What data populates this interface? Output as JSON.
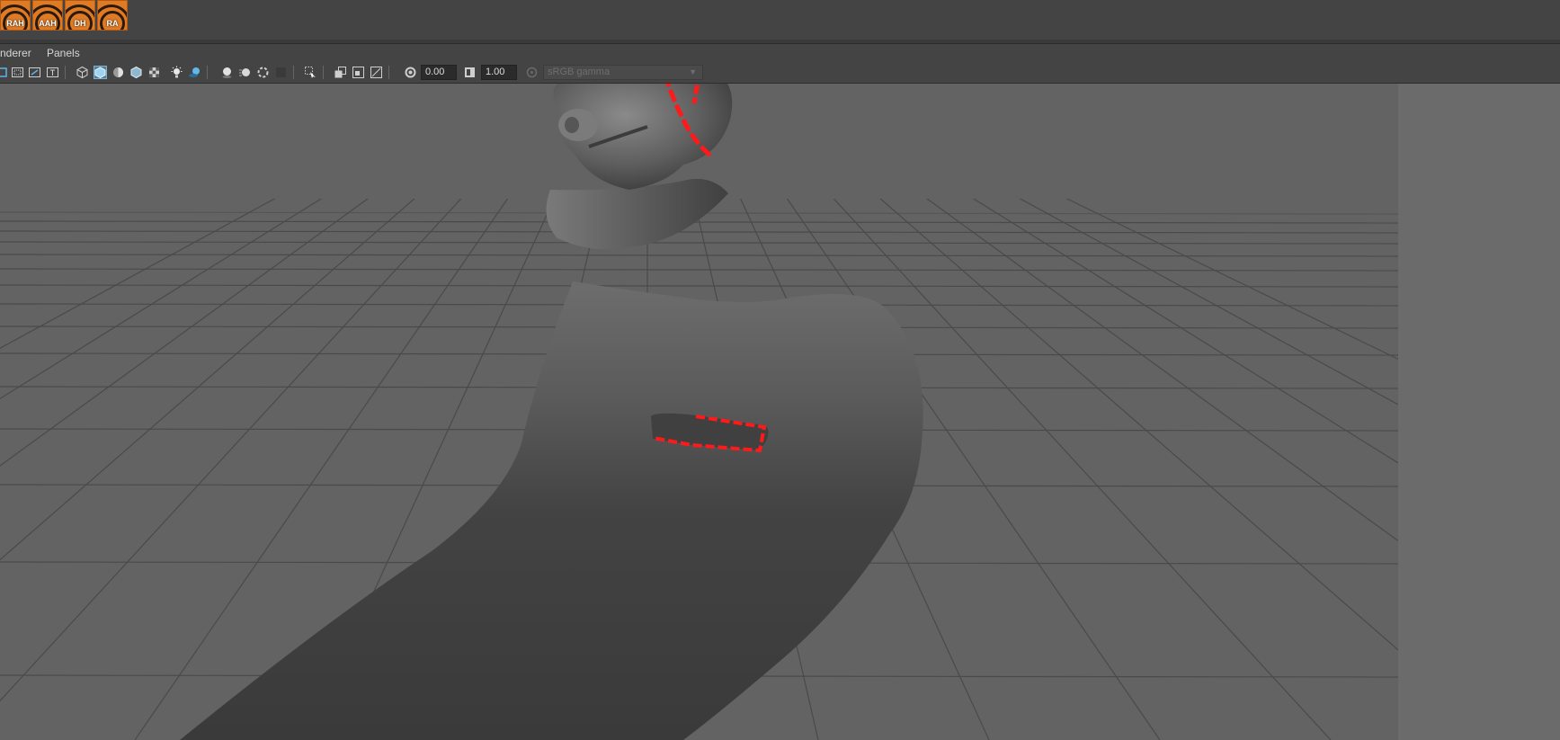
{
  "shelf": {
    "buttons": [
      {
        "label": "RAH"
      },
      {
        "label": "AAH"
      },
      {
        "label": "DH"
      },
      {
        "label": "RA"
      }
    ]
  },
  "menubar": {
    "items": [
      "nderer",
      "Panels"
    ]
  },
  "toolbar": {
    "exposure_value": "0.00",
    "gamma_value": "1.00",
    "color_space": "sRGB gamma"
  },
  "colors": {
    "shelf_orange": "#e07b25",
    "viewport_bg": "#636363",
    "selection_highlight": "#ff1a1a"
  },
  "icons": [
    "camera-attributes-icon",
    "image-plane-icon",
    "2d-pan-zoom-icon",
    "grease-pencil-icon",
    "wireframe-icon",
    "smooth-shade-icon",
    "default-material-icon",
    "textured-icon",
    "checker-icon",
    "use-all-lights-icon",
    "shadows-icon",
    "screen-space-ao-icon",
    "motion-blur-icon",
    "anti-aliasing-icon",
    "depth-of-field-icon",
    "isolate-select-icon",
    "xray-icon",
    "xray-joints-icon",
    "backface-icon",
    "exposure-icon",
    "gamma-icon",
    "color-management-icon"
  ]
}
